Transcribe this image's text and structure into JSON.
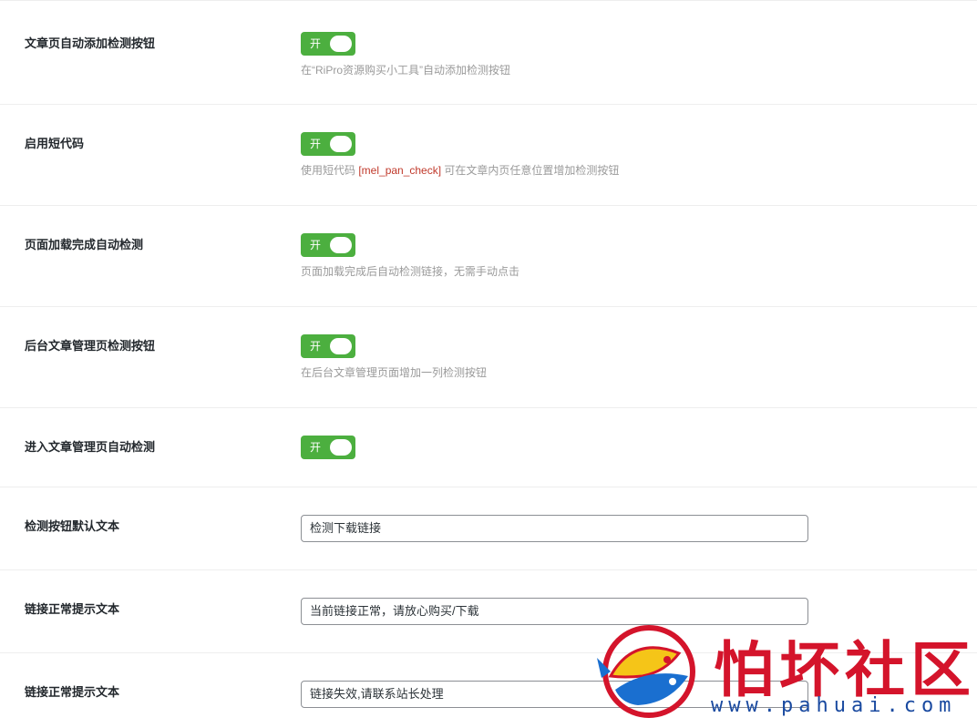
{
  "settings": [
    {
      "label": "文章页自动添加检测按钮",
      "type": "toggle",
      "state": "开",
      "desc": "在“RiPro资源购买小工具”自动添加检测按钮"
    },
    {
      "label": "启用短代码",
      "type": "toggle",
      "state": "开",
      "desc_pre": "使用短代码 ",
      "desc_code": "[mel_pan_check]",
      "desc_post": " 可在文章内页任意位置增加检测按钮"
    },
    {
      "label": "页面加载完成自动检测",
      "type": "toggle",
      "state": "开",
      "desc": "页面加载完成后自动检测链接，无需手动点击"
    },
    {
      "label": "后台文章管理页检测按钮",
      "type": "toggle",
      "state": "开",
      "desc": "在后台文章管理页面增加一列检测按钮"
    },
    {
      "label": "进入文章管理页自动检测",
      "type": "toggle",
      "state": "开"
    },
    {
      "label": "检测按钮默认文本",
      "type": "text",
      "value": "检测下载链接"
    },
    {
      "label": "链接正常提示文本",
      "type": "text",
      "value": "当前链接正常，请放心购买/下载"
    },
    {
      "label": "链接正常提示文本",
      "type": "text",
      "value": "链接失效,请联系站长处理"
    }
  ],
  "watermark": {
    "text": "怕坏社区",
    "url": "www.pahuai.com"
  },
  "colors": {
    "toggle_on": "#4caf3f",
    "code": "#c0392b",
    "watermark_red": "#d4142b",
    "watermark_blue": "#1a4aa0"
  }
}
